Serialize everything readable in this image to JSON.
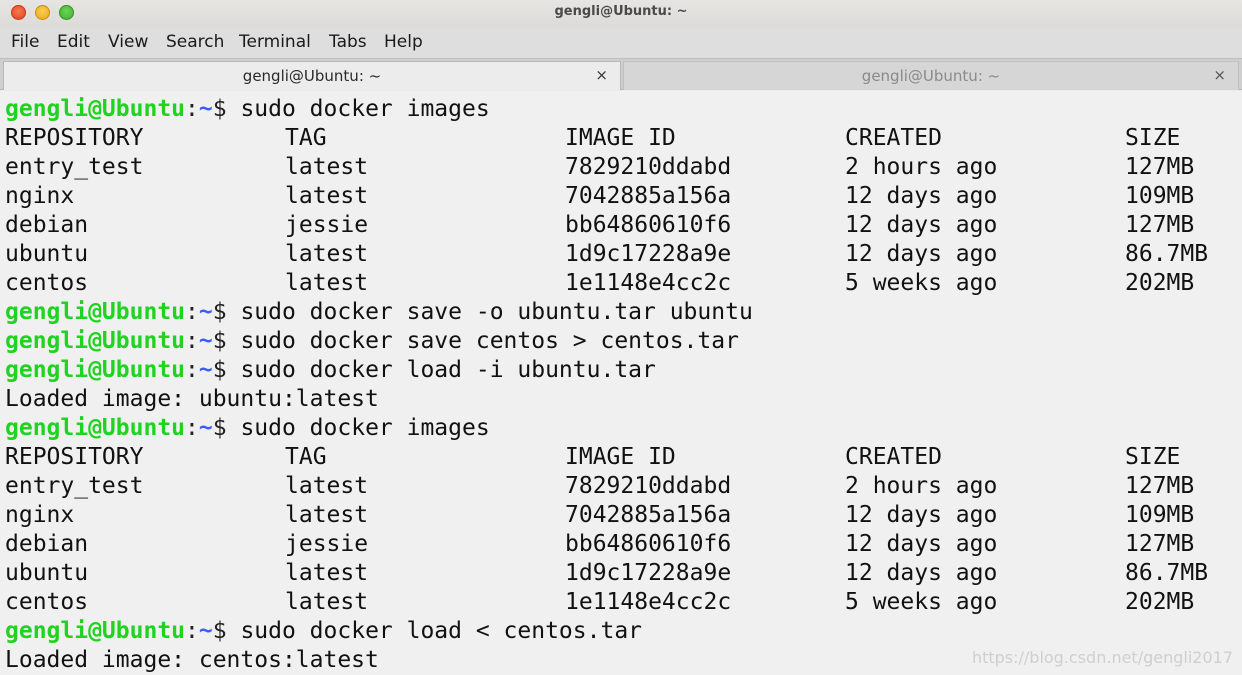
{
  "window": {
    "title": "gengli@Ubuntu: ~"
  },
  "menu": [
    "File",
    "Edit",
    "View",
    "Search",
    "Terminal",
    "Tabs",
    "Help"
  ],
  "tabs": [
    {
      "label": "gengli@Ubuntu: ~",
      "close": "×",
      "active": true
    },
    {
      "label": "gengli@Ubuntu: ~",
      "close": "×",
      "active": false
    }
  ],
  "prompt": {
    "user": "gengli@Ubuntu",
    "colon": ":",
    "path": "~",
    "dollar": "$"
  },
  "colors": {
    "prompt_user": "#1fd41f",
    "prompt_path": "#3b5dff",
    "terminal_bg": "#f0f0f0"
  },
  "lines": [
    {
      "type": "cmd",
      "text": " sudo docker images"
    },
    {
      "type": "row",
      "cols": [
        "REPOSITORY",
        "TAG",
        "IMAGE ID",
        "CREATED",
        "SIZE"
      ]
    },
    {
      "type": "row",
      "cols": [
        "entry_test",
        "latest",
        "7829210ddabd",
        "2 hours ago",
        "127MB"
      ]
    },
    {
      "type": "row",
      "cols": [
        "nginx",
        "latest",
        "7042885a156a",
        "12 days ago",
        "109MB"
      ]
    },
    {
      "type": "row",
      "cols": [
        "debian",
        "jessie",
        "bb64860610f6",
        "12 days ago",
        "127MB"
      ]
    },
    {
      "type": "row",
      "cols": [
        "ubuntu",
        "latest",
        "1d9c17228a9e",
        "12 days ago",
        "86.7MB"
      ]
    },
    {
      "type": "row",
      "cols": [
        "centos",
        "latest",
        "1e1148e4cc2c",
        "5 weeks ago",
        "202MB"
      ]
    },
    {
      "type": "cmd",
      "text": " sudo docker save -o ubuntu.tar ubuntu"
    },
    {
      "type": "cmd",
      "text": " sudo docker save centos > centos.tar"
    },
    {
      "type": "cmd",
      "text": " sudo docker load -i ubuntu.tar"
    },
    {
      "type": "out",
      "text": "Loaded image: ubuntu:latest"
    },
    {
      "type": "cmd",
      "text": " sudo docker images"
    },
    {
      "type": "row",
      "cols": [
        "REPOSITORY",
        "TAG",
        "IMAGE ID",
        "CREATED",
        "SIZE"
      ]
    },
    {
      "type": "row",
      "cols": [
        "entry_test",
        "latest",
        "7829210ddabd",
        "2 hours ago",
        "127MB"
      ]
    },
    {
      "type": "row",
      "cols": [
        "nginx",
        "latest",
        "7042885a156a",
        "12 days ago",
        "109MB"
      ]
    },
    {
      "type": "row",
      "cols": [
        "debian",
        "jessie",
        "bb64860610f6",
        "12 days ago",
        "127MB"
      ]
    },
    {
      "type": "row",
      "cols": [
        "ubuntu",
        "latest",
        "1d9c17228a9e",
        "12 days ago",
        "86.7MB"
      ]
    },
    {
      "type": "row",
      "cols": [
        "centos",
        "latest",
        "1e1148e4cc2c",
        "5 weeks ago",
        "202MB"
      ]
    },
    {
      "type": "cmd",
      "text": " sudo docker load < centos.tar"
    },
    {
      "type": "out",
      "text": "Loaded image: centos:latest"
    }
  ],
  "watermark": "https://blog.csdn.net/gengli2017"
}
